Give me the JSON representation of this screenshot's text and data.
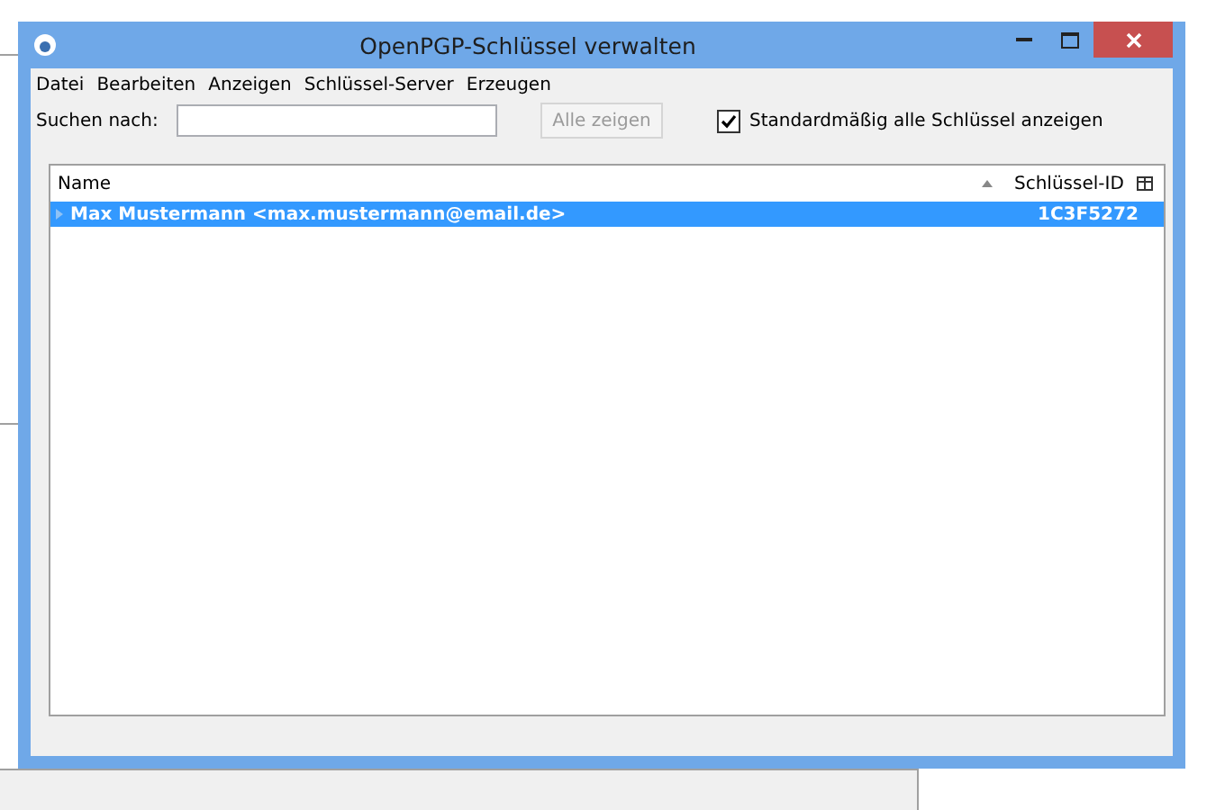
{
  "window": {
    "title": "OpenPGP-Schlüssel verwalten"
  },
  "menu": [
    {
      "label": "Datei"
    },
    {
      "label": "Bearbeiten"
    },
    {
      "label": "Anzeigen"
    },
    {
      "label": "Schlüssel-Server"
    },
    {
      "label": "Erzeugen"
    }
  ],
  "search": {
    "label": "Suchen nach:"
  },
  "show_all_button": {
    "label": "Alle zeigen",
    "disabled": true
  },
  "default_checkbox": {
    "label": "Standardmäßig alle Schlüssel anzeigen",
    "checked": true
  },
  "table": {
    "columns": [
      {
        "label": "Name",
        "sorted": true
      },
      {
        "label": "Schlüssel-ID",
        "sorted": false
      }
    ],
    "rows": [
      {
        "name": "Max Mustermann <max.mustermann@email.de>",
        "key_id": "1C3F5272",
        "selected": true
      }
    ]
  }
}
